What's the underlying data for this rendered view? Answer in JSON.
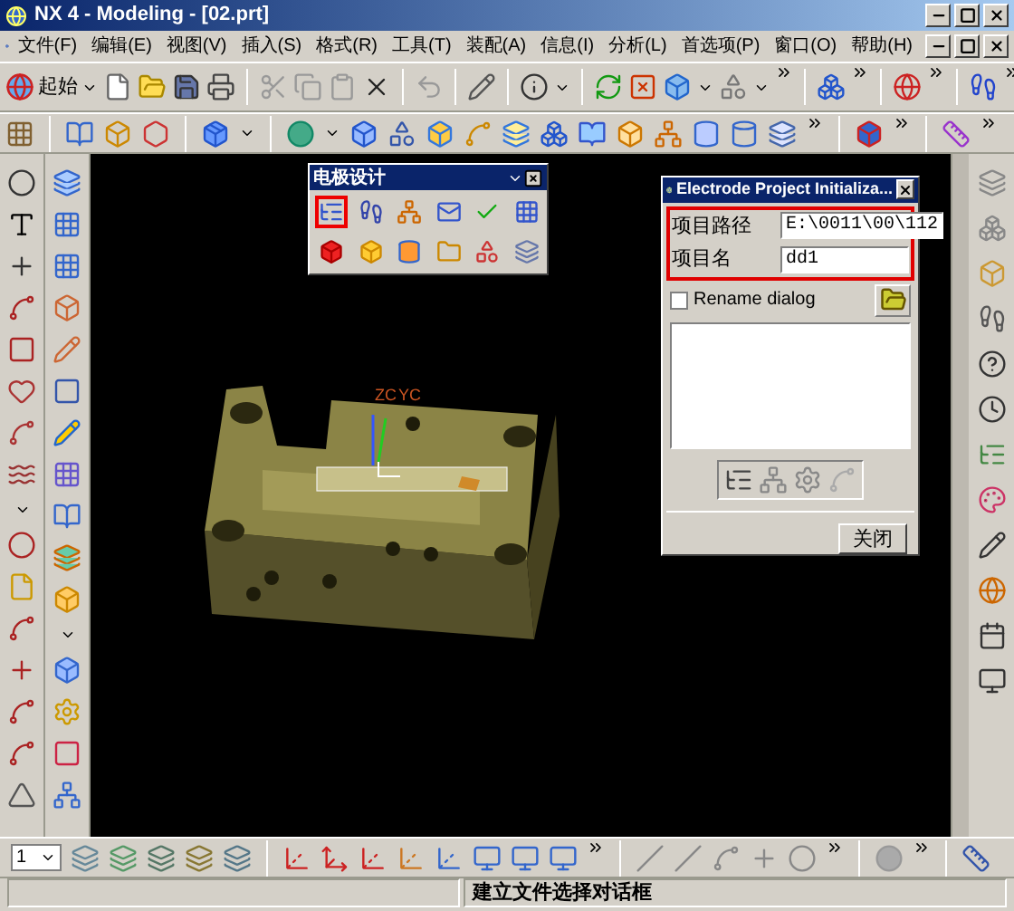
{
  "window": {
    "title": "NX 4 - Modeling - [02.prt]"
  },
  "menu_bar": [
    {
      "label": "文件(F)"
    },
    {
      "label": "编辑(E)"
    },
    {
      "label": "视图(V)"
    },
    {
      "label": "插入(S)"
    },
    {
      "label": "格式(R)"
    },
    {
      "label": "工具(T)"
    },
    {
      "label": "装配(A)"
    },
    {
      "label": "信息(I)"
    },
    {
      "label": "分析(L)"
    },
    {
      "label": "首选项(P)"
    },
    {
      "label": "窗口(O)"
    },
    {
      "label": "帮助(H)"
    }
  ],
  "standard_toolbar": {
    "start_button": "起始"
  },
  "electrode_toolbar": {
    "title": "电极设计",
    "buttons": [
      {
        "highlighted": true
      },
      {
        "highlighted": false
      },
      {
        "highlighted": false
      },
      {
        "highlighted": false
      },
      {
        "highlighted": false
      },
      {
        "highlighted": false
      },
      {
        "highlighted": false
      },
      {
        "highlighted": false
      },
      {
        "highlighted": false
      },
      {
        "highlighted": false
      },
      {
        "highlighted": false
      },
      {
        "highlighted": false
      }
    ]
  },
  "viewport": {
    "axis_labels": [
      "ZC",
      "YC"
    ]
  },
  "dialog": {
    "title": "Electrode Project Initializa...",
    "fields_highlighted": true,
    "fields": [
      {
        "label": "项目路径",
        "value": "E:\\0011\\00\\112"
      },
      {
        "label": "项目名",
        "value": "dd1"
      }
    ],
    "rename_checkbox": {
      "label": "Rename dialog",
      "checked": false
    },
    "close_button": "关闭"
  },
  "bottom_toolbar": {
    "layer": "1"
  },
  "status_bar": {
    "message": "建立文件选择对话框"
  }
}
